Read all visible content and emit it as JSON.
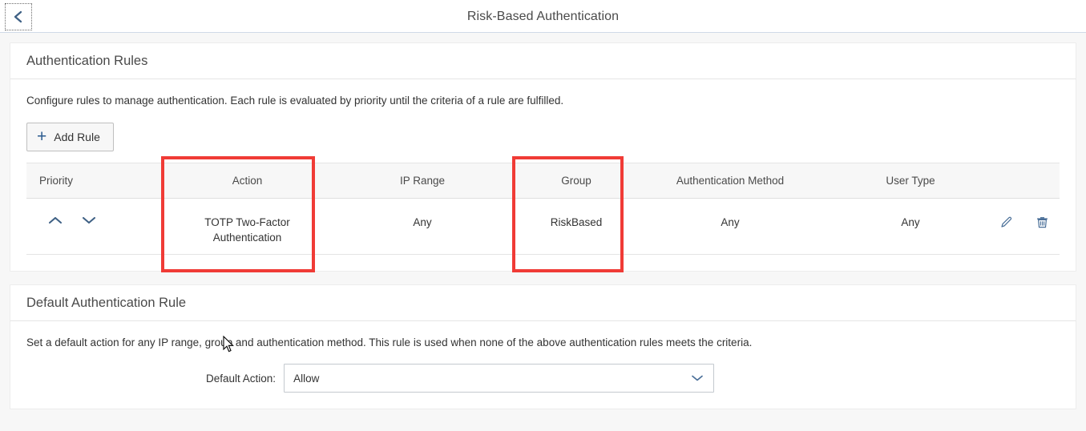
{
  "topbar": {
    "back_icon": "chevron-left-icon",
    "title": "Risk-Based Authentication"
  },
  "colors": {
    "accent_blue": "#2c5b8f",
    "link_blue": "#4a6f98",
    "annotation_red": "#f03b36",
    "header_separator": "#d0dae8",
    "page_background": "#f7f7f7",
    "card_background": "#ffffff",
    "table_header_background": "#f7f7f7",
    "text_primary": "#333333",
    "text_secondary": "#4a4a4a"
  },
  "auth_rules_section": {
    "title": "Authentication Rules",
    "description": "Configure rules to manage authentication. Each rule is evaluated by priority until the criteria of a rule are fulfilled.",
    "add_rule_label": "Add Rule",
    "add_rule_icon": "plus-icon",
    "table": {
      "columns": [
        "Priority",
        "Action",
        "IP Range",
        "Group",
        "Authentication Method",
        "User Type"
      ],
      "rows": [
        {
          "priority_up_icon": "chevron-up-icon",
          "priority_down_icon": "chevron-down-icon",
          "action": "TOTP Two-Factor Authentication",
          "ip_range": "Any",
          "group": "RiskBased",
          "authentication_method": "Any",
          "user_type": "Any",
          "edit_icon": "pencil-icon",
          "delete_icon": "trash-icon"
        }
      ]
    }
  },
  "default_rule_section": {
    "title": "Default Authentication Rule",
    "description": "Set a default action for any IP range, group and authentication method. This rule is used when none of the above authentication rules meets the criteria.",
    "default_action_label": "Default Action:",
    "default_action_value": "Allow",
    "default_action_chevron_icon": "chevron-down-icon"
  },
  "annotations": [
    {
      "name": "action-column-highlight",
      "target": "Action"
    },
    {
      "name": "group-column-highlight",
      "target": "Group"
    }
  ],
  "cursor": {
    "icon": "mouse-pointer-icon"
  }
}
